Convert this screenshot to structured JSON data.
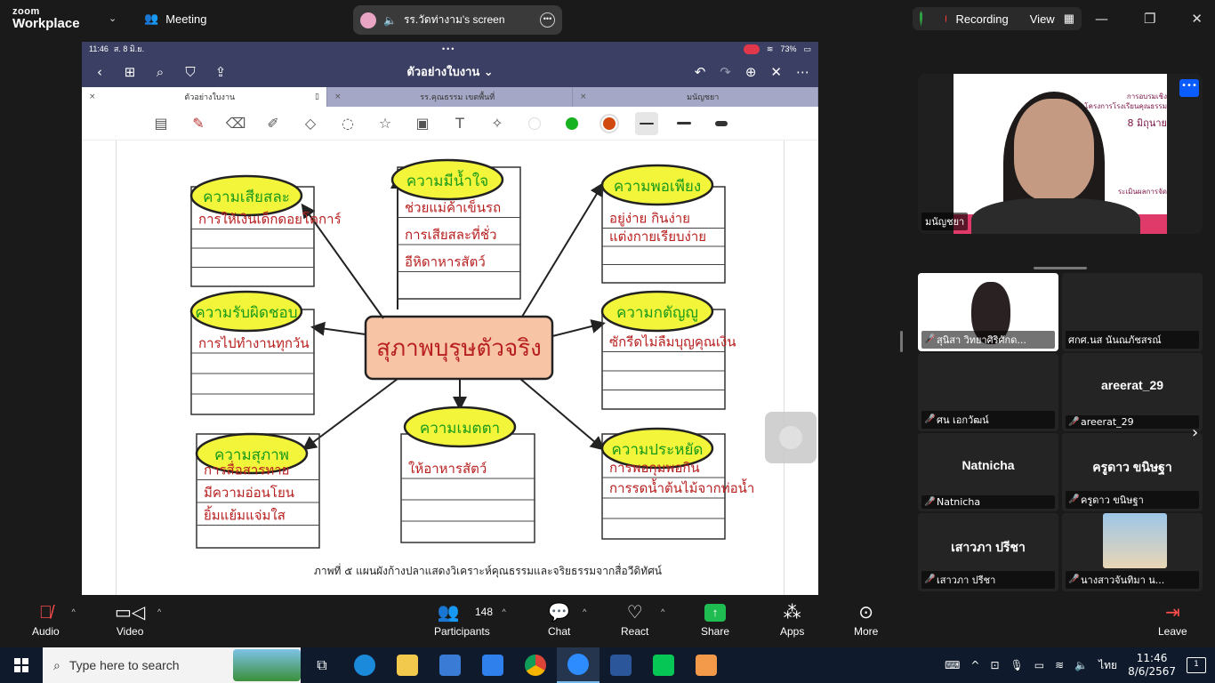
{
  "zoom": {
    "brand_line1": "zoom",
    "brand_line2": "Workplace",
    "meeting_label": "Meeting",
    "share_label": "รร.วัดท่างาม's screen",
    "recording_label": "Recording",
    "view_label": "View"
  },
  "tablet": {
    "time": "11:46",
    "date": "ส. 8 มิ.ย.",
    "battery": "73%",
    "doc_title": "ตัวอย่างใบงาน",
    "tabs": [
      {
        "label": "ตัวอย่างใบงาน",
        "active": true
      },
      {
        "label": "รร.คุณธรรม เขตพื้นที่",
        "active": false
      },
      {
        "label": "มนัญชยา",
        "active": false
      }
    ],
    "colors": {
      "green": "#17b21f",
      "orange": "#d04a10",
      "ink_green": "#1a9a1a",
      "ink_red": "#b82020",
      "bubble": "#f3f53a",
      "center": "#f7c4a6"
    },
    "caption": "ภาพที่ ๕ แผนผังก้างปลาแสดงวิเคราะห์คุณธรรมและจริยธรรมจากสื่อวีดิทัศน์"
  },
  "diagram": {
    "center": "สุภาพบุรุษตัวจริง",
    "nodes": [
      {
        "title": "ความเสียสละ",
        "lines": [
          "การให้เงินเด็กดอยโคการ์"
        ]
      },
      {
        "title": "ความมีน้ำใจ",
        "lines": [
          "ช่วยแม่ค้าเข็นรถ",
          "การเสียสละที่ชั่ว",
          "อีหิดาหารสัตว์"
        ]
      },
      {
        "title": "ความพอเพียง",
        "lines": [
          "อยู่ง่าย กินง่าย",
          "แต่งกายเรียบง่าย"
        ]
      },
      {
        "title": "ความรับผิดชอบ",
        "lines": [
          "การไปทำงานทุกวัน"
        ]
      },
      {
        "title": "ความกตัญญู",
        "lines": [
          "ซักรีดไม่ลืมบุญคุณเงิน"
        ]
      },
      {
        "title": "ความสุภาพ",
        "lines": [
          "การสื่อสารทาย",
          "มีความอ่อนโยน",
          "ยิ้มแย้มแจ่มใส"
        ]
      },
      {
        "title": "ความเมตตา",
        "lines": [
          "ให้อาหารสัตว์"
        ]
      },
      {
        "title": "ความประหยัด",
        "lines": [
          "การพอกุมพอกิน",
          "การรดน้ำต้นไม้จากท่อน้ำ"
        ]
      }
    ]
  },
  "participants_panel": {
    "active_speaker": "มนัญชยา",
    "slide_title": "การอบรมเชิง",
    "slide_sub": "การพัฒนา...เขื่อนโครงการโรงเรียนคุณธรรม",
    "slide_date": "8 มิถุนาย",
    "slide_bottom": "ระเมินผลการจัด",
    "tiles": [
      {
        "name": "สุนิสา วิทยาศิริศักด...",
        "big": "",
        "muted": true,
        "type": "slide"
      },
      {
        "name": "ศกศ.นส นันณภัชสรณ์",
        "big": "",
        "muted": false,
        "type": "blank"
      },
      {
        "name": "ศน เอกวัฒน์",
        "big": "",
        "muted": true,
        "type": "blank"
      },
      {
        "name": "areerat_29",
        "big": "areerat_29",
        "muted": true,
        "type": "name"
      },
      {
        "name": "Natnicha",
        "big": "Natnicha",
        "muted": true,
        "type": "name"
      },
      {
        "name": "ครูดาว ขนิษฐา",
        "big": "ครูดาว ขนิษฐา",
        "muted": true,
        "type": "name"
      },
      {
        "name": "เสาวภา ปรีชา",
        "big": "เสาวภา ปรีชา",
        "muted": true,
        "type": "name"
      },
      {
        "name": "นางสาวจันทิมา น...",
        "big": "",
        "muted": true,
        "type": "photo"
      }
    ]
  },
  "controls": {
    "audio": "Audio",
    "video": "Video",
    "participants": "Participants",
    "participants_count": "148",
    "chat": "Chat",
    "react": "React",
    "share": "Share",
    "apps": "Apps",
    "more": "More",
    "leave": "Leave"
  },
  "taskbar": {
    "search_placeholder": "Type here to search",
    "lang": "ไทย",
    "time": "11:46",
    "date": "8/6/2567",
    "notifications": "1"
  }
}
